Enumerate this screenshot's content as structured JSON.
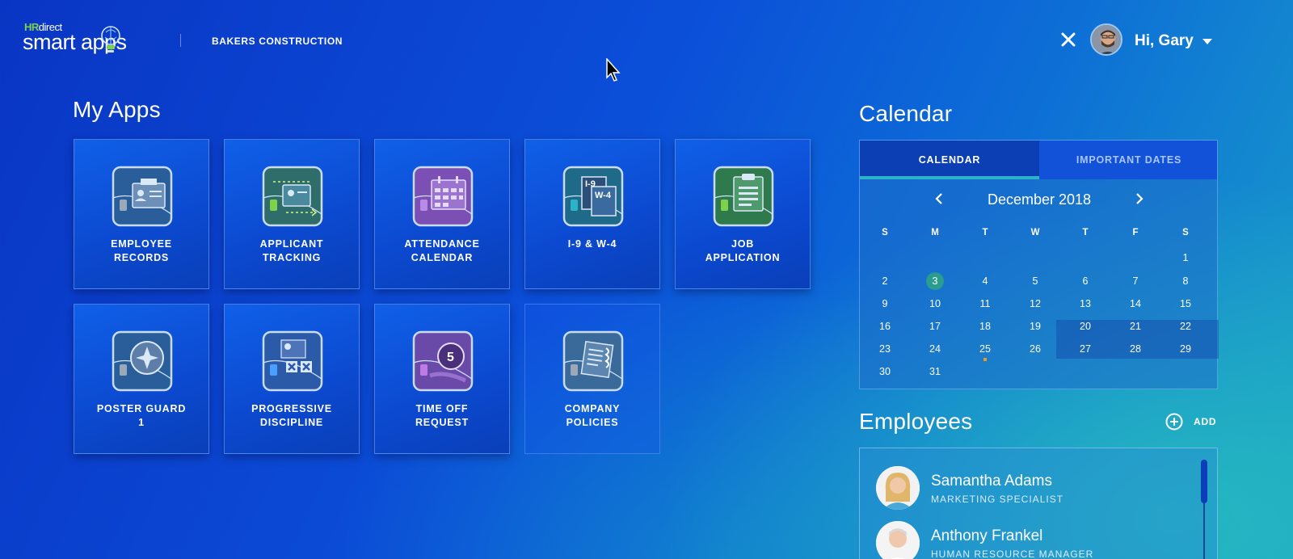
{
  "header": {
    "logo_hr": "HR",
    "logo_direct": "direct",
    "logo_name": "smart apps",
    "company": "BAKERS CONSTRUCTION",
    "greeting": "Hi, Gary"
  },
  "apps": {
    "title": "My Apps",
    "tiles": [
      {
        "line1": "EMPLOYEE",
        "line2": "RECORDS"
      },
      {
        "line1": "APPLICANT",
        "line2": "TRACKING"
      },
      {
        "line1": "ATTENDANCE",
        "line2": "CALENDAR"
      },
      {
        "line1": "I-9 & W-4",
        "line2": ""
      },
      {
        "line1": "JOB",
        "line2": "APPLICATION"
      },
      {
        "line1": "POSTER GUARD",
        "line2": "1"
      },
      {
        "line1": "PROGRESSIVE",
        "line2": "DISCIPLINE"
      },
      {
        "line1": "TIME OFF",
        "line2": "REQUEST"
      },
      {
        "line1": "COMPANY",
        "line2": "POLICIES"
      }
    ],
    "icon_labels": {
      "i9": "I-9",
      "w4": "W-4",
      "time_off": "5"
    }
  },
  "calendar": {
    "title": "Calendar",
    "tabs": [
      "CALENDAR",
      "IMPORTANT DATES"
    ],
    "month": "December 2018",
    "weekdays": [
      "S",
      "M",
      "T",
      "W",
      "T",
      "F",
      "S"
    ],
    "days": [
      "1",
      "2",
      "3",
      "4",
      "5",
      "6",
      "7",
      "8",
      "9",
      "10",
      "11",
      "12",
      "13",
      "14",
      "15",
      "16",
      "17",
      "18",
      "19",
      "20",
      "21",
      "22",
      "23",
      "24",
      "25",
      "26",
      "27",
      "28",
      "29",
      "30",
      "31"
    ],
    "first_weekday": 6,
    "today": 3,
    "event_day": 25
  },
  "employees": {
    "title": "Employees",
    "add_label": "ADD",
    "list": [
      {
        "name": "Samantha Adams",
        "role": "MARKETING SPECIALIST"
      },
      {
        "name": "Anthony Frankel",
        "role": "HUMAN RESOURCE MANAGER"
      }
    ]
  },
  "colors": {
    "accent_teal": "#2bb3c9",
    "today_green": "#2a9d8f",
    "event_orange": "#f39c12",
    "logo_green": "#7fd14a"
  }
}
